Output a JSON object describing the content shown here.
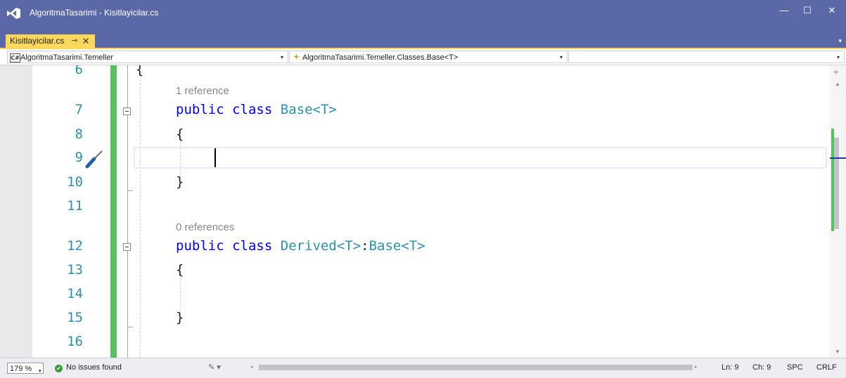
{
  "window": {
    "title": "AlgoritmaTasarimi - Kisitlayicilar.cs",
    "minimize_glyph": "—",
    "maximize_glyph": "☐",
    "close_glyph": "✕",
    "title_color": "#5a68a8"
  },
  "tab": {
    "label": "Kisitlayicilar.cs",
    "pin_glyph": "⊸",
    "close_glyph": "✕",
    "accent": "#fbd75b"
  },
  "navbar": {
    "project": "AlgoritmaTasarimi.Temeller",
    "project_icon": "C#",
    "class_path": "AlgoritmaTasarimi.Temeller.Classes.Base<T>",
    "class_icon": "✦",
    "member": "",
    "dropdown_glyph": "▾"
  },
  "editor": {
    "line_numbers": [
      "6",
      "7",
      "8",
      "9",
      "10",
      "11",
      "12",
      "13",
      "14",
      "15",
      "16"
    ],
    "codelens": [
      "1 reference",
      "0 references"
    ],
    "code": {
      "brace_open": "{",
      "brace_close": "}",
      "kw_public": "public",
      "kw_class": "class",
      "type_base": "Base<T>",
      "type_derived": "Derived<T>",
      "colon": ":"
    },
    "split_glyph": "÷",
    "up_glyph": "▲",
    "down_glyph": "▼",
    "change_color": "#57c25d"
  },
  "statusbar": {
    "zoom": "179 %",
    "zoom_arrow": "▾",
    "issues": "No issues found",
    "check_glyph": "✔",
    "brush_glyph": "✎ ▾",
    "left_glyph": "◂",
    "right_glyph": "▸",
    "line": "Ln: 9",
    "char": "Ch: 9",
    "indent": "SPC",
    "eol": "CRLF"
  }
}
